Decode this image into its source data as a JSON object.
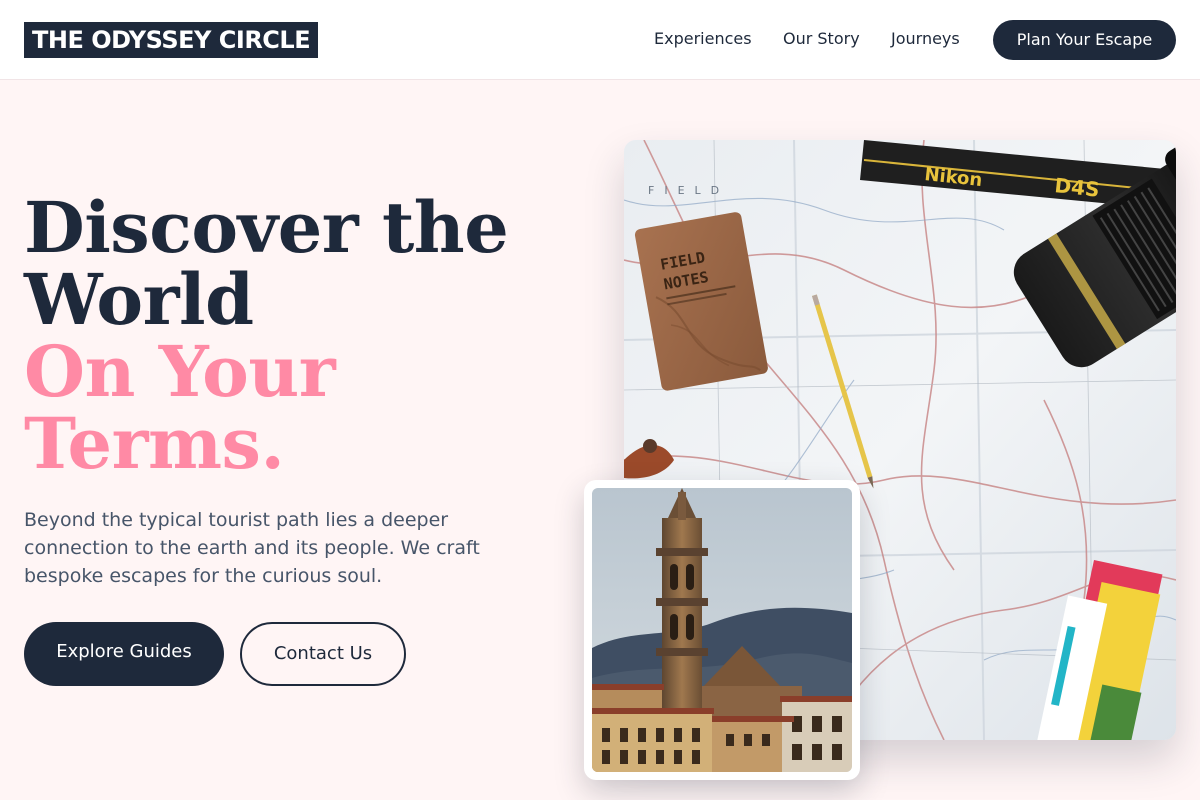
{
  "brand": {
    "name": "THE ODYSSEY CIRCLE"
  },
  "nav": {
    "links": [
      "Experiences",
      "Our Story",
      "Journeys"
    ],
    "cta": "Plan Your Escape"
  },
  "hero": {
    "headline_line1": "Discover the",
    "headline_line2": "World",
    "headline_accent_line1": "On Your",
    "headline_accent_line2": "Terms.",
    "description": "Beyond the typical tourist path lies a deeper connection to the earth and its people. We craft bespoke escapes for the curious soul.",
    "primary_button": "Explore Guides",
    "secondary_button": "Contact Us"
  },
  "images": {
    "map_photo": {
      "notebook_text_1": "FIELD",
      "notebook_text_2": "NOTES",
      "strap_text_1": "Nikon",
      "strap_text_2": "D4S"
    }
  },
  "colors": {
    "navy": "#1e293b",
    "accent_pink": "#ff8aa5",
    "background": "#fff5f5",
    "body_text": "#475569"
  }
}
